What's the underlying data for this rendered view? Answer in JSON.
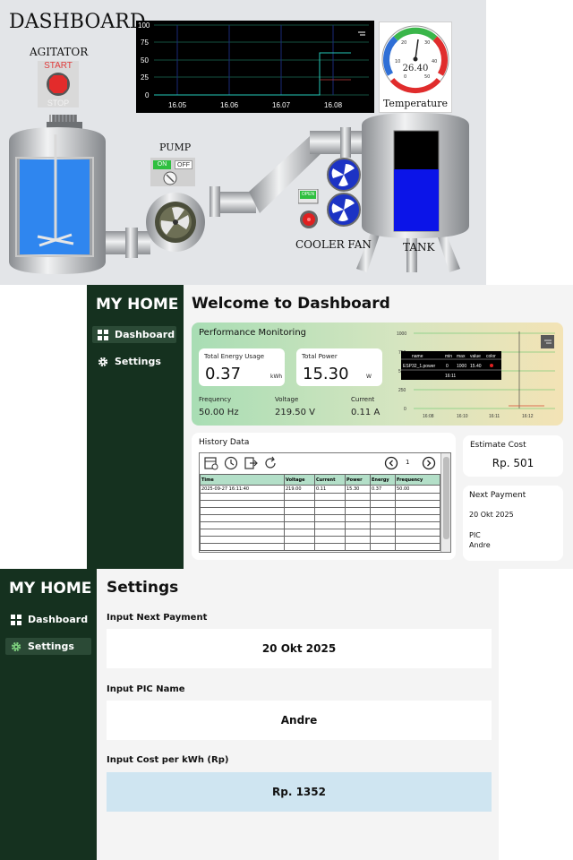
{
  "scada": {
    "title": "DASHBOARD",
    "agitator_label": "AGITATOR",
    "start_label": "START",
    "stop_label": "STOP",
    "pump_label": "PUMP",
    "pump_on": "ON",
    "pump_off": "OFF",
    "cooler_label": "COOLER FAN",
    "cooler_switch_label": "OPEN",
    "tank_label": "TANK",
    "tank_level": 0.62,
    "trend": {
      "y_ticks": [
        "100",
        "75",
        "50",
        "25",
        "0"
      ],
      "x_ticks": [
        "16.05",
        "16.06",
        "16.07",
        "16.08"
      ]
    },
    "gauge": {
      "label": "Temperature",
      "value": "26.40",
      "ticks": [
        "0",
        "10",
        "20",
        "30",
        "40",
        "50"
      ]
    }
  },
  "dashboard": {
    "brand": "MY HOME",
    "nav": [
      {
        "label": "Dashboard",
        "icon": "grid-icon",
        "active": true
      },
      {
        "label": "Settings",
        "icon": "gear-icon",
        "active": false
      }
    ],
    "title": "Welcome to Dashboard",
    "performance": {
      "title": "Performance Monitoring",
      "total_energy_label": "Total Energy Usage",
      "total_energy_value": "0.37",
      "total_energy_unit": "kWh",
      "total_power_label": "Total Power",
      "total_power_value": "15.30",
      "total_power_unit": "W",
      "frequency_label": "Frequency",
      "frequency_value": "50.00  Hz",
      "voltage_label": "Voltage",
      "voltage_value": "219.50  V",
      "current_label": "Current",
      "current_value": "0.11  A"
    },
    "perf_chart": {
      "y_ticks": [
        "1000",
        "750",
        "500",
        "250",
        "0"
      ],
      "x_ticks": [
        "16:08",
        "16:10",
        "16:11",
        "16:12"
      ],
      "tooltip_headers": [
        "name",
        "min",
        "max",
        "value",
        "color"
      ],
      "tooltip_row": [
        "ESP32_1.power",
        "0",
        "1000",
        "15.40"
      ],
      "tooltip_time": "16:11"
    },
    "history": {
      "title": "History Data",
      "page": "1",
      "columns": [
        "Time",
        "Voltage",
        "Current",
        "Power",
        "Energy",
        "Frequency"
      ],
      "rows": [
        [
          "2025-09-27 16:11:40",
          "219.00",
          "0.11",
          "15.30",
          "0.37",
          "50.00"
        ]
      ]
    },
    "estimate": {
      "label": "Estimate Cost",
      "value": "Rp.  501"
    },
    "next_payment": {
      "label": "Next Payment",
      "date": "20 Okt 2025",
      "pic_label": "PIC",
      "pic_name": "Andre"
    }
  },
  "settings": {
    "brand": "MY HOME",
    "nav": [
      {
        "label": "Dashboard",
        "icon": "grid-icon",
        "active": false
      },
      {
        "label": "Settings",
        "icon": "gear-icon",
        "active": true
      }
    ],
    "title": "Settings",
    "next_payment_label": "Input Next Payment",
    "next_payment_value": "20 Okt 2025",
    "pic_label": "Input PIC Name",
    "pic_value": "Andre",
    "cost_label": "Input Cost per kWh (Rp)",
    "cost_value": "Rp. 1352"
  }
}
